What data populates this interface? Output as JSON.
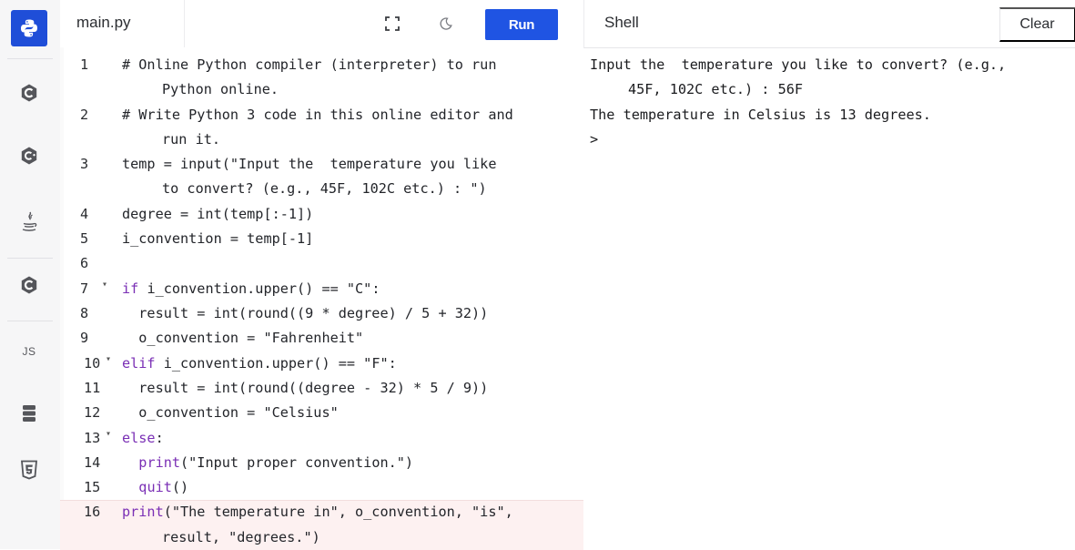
{
  "sidebar": {
    "items": [
      {
        "name": "python-icon",
        "label": "Python"
      },
      {
        "name": "c-icon",
        "label": "C"
      },
      {
        "name": "cpp-icon",
        "label": "C++"
      },
      {
        "name": "java-icon",
        "label": "Java"
      },
      {
        "name": "csharp-icon",
        "label": "C#"
      },
      {
        "name": "js-icon",
        "label": "JS"
      },
      {
        "name": "database-icon",
        "label": "SQL"
      },
      {
        "name": "html5-icon",
        "label": "HTML"
      }
    ],
    "accent": "#1f4ed8"
  },
  "editor": {
    "filename": "main.py",
    "fullscreen_icon": "fullscreen-icon",
    "theme_icon": "moon-icon",
    "run_label": "Run",
    "run_color": "#1f54e3",
    "lines": [
      {
        "n": "1",
        "fold": "",
        "text": "# Online Python compiler (interpreter) to run",
        "cont": "Python online."
      },
      {
        "n": "2",
        "fold": "",
        "text": "# Write Python 3 code in this online editor and",
        "cont": "run it."
      },
      {
        "n": "3",
        "fold": "",
        "text": "temp = input(\"Input the  temperature you like",
        "cont": "to convert? (e.g., 45F, 102C etc.) : \")"
      },
      {
        "n": "4",
        "fold": "",
        "text": "degree = int(temp[:-1])",
        "cont": ""
      },
      {
        "n": "5",
        "fold": "",
        "text": "i_convention = temp[-1]",
        "cont": ""
      },
      {
        "n": "6",
        "fold": "",
        "text": "",
        "cont": ""
      },
      {
        "n": "7",
        "fold": "▾",
        "text": "if i_convention.upper() == \"C\":",
        "cont": ""
      },
      {
        "n": "8",
        "fold": "",
        "text": "  result = int(round((9 * degree) / 5 + 32))",
        "cont": ""
      },
      {
        "n": "9",
        "fold": "",
        "text": "  o_convention = \"Fahrenheit\"",
        "cont": ""
      },
      {
        "n": "10",
        "fold": "▾",
        "text": "elif i_convention.upper() == \"F\":",
        "cont": ""
      },
      {
        "n": "11",
        "fold": "",
        "text": "  result = int(round((degree - 32) * 5 / 9))",
        "cont": ""
      },
      {
        "n": "12",
        "fold": "",
        "text": "  o_convention = \"Celsius\"",
        "cont": ""
      },
      {
        "n": "13",
        "fold": "▾",
        "text": "else:",
        "cont": ""
      },
      {
        "n": "14",
        "fold": "",
        "text": "  print(\"Input proper convention.\")",
        "cont": ""
      },
      {
        "n": "15",
        "fold": "",
        "text": "  quit()",
        "cont": ""
      },
      {
        "n": "16",
        "fold": "",
        "text": "print(\"The temperature in\", o_convention, \"is\",",
        "cont": "result, \"degrees.\")"
      }
    ]
  },
  "shell": {
    "title": "Shell",
    "clear_label": "Clear",
    "output": [
      {
        "text": "Input the  temperature you like to convert? (e.g.,",
        "cont": "45F, 102C etc.) : 56F"
      },
      {
        "text": "The temperature in Celsius is 13 degrees.",
        "cont": ""
      },
      {
        "text": ">",
        "cont": ""
      }
    ]
  }
}
